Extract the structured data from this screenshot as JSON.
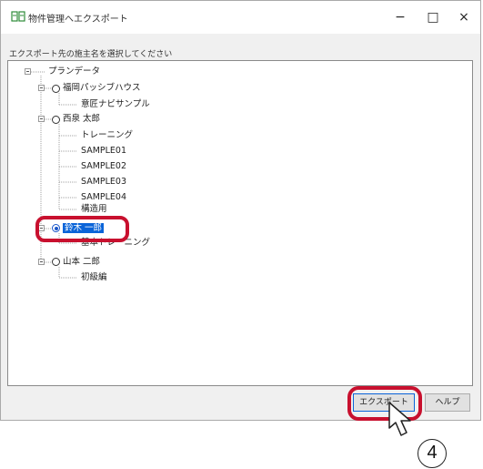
{
  "window": {
    "title": "物件管理へエクスポート",
    "minimize_glyph": "−",
    "maximize_glyph": "□",
    "close_glyph": "×"
  },
  "prompt": "エクスポート先の施主名を選択してください",
  "tree": {
    "root_label": "プランデータ",
    "owners": [
      {
        "label": "福岡パッシブハウス",
        "selected": false,
        "children": [
          "意匠ナビサンプル"
        ]
      },
      {
        "label": "西泉 太郎",
        "selected": false,
        "children": [
          "トレーニング",
          "SAMPLE01",
          "SAMPLE02",
          "SAMPLE03",
          "SAMPLE04",
          "構造用"
        ]
      },
      {
        "label": "鈴木 一郎",
        "selected": true,
        "children": [
          "基本トレーニング"
        ]
      },
      {
        "label": "山本 二郎",
        "selected": false,
        "children": [
          "初級編"
        ]
      }
    ]
  },
  "buttons": {
    "export_label": "エクスポート",
    "help_label": "ヘルプ"
  },
  "annotation": {
    "step_number": "4",
    "highlight_color": "#c8102e"
  }
}
